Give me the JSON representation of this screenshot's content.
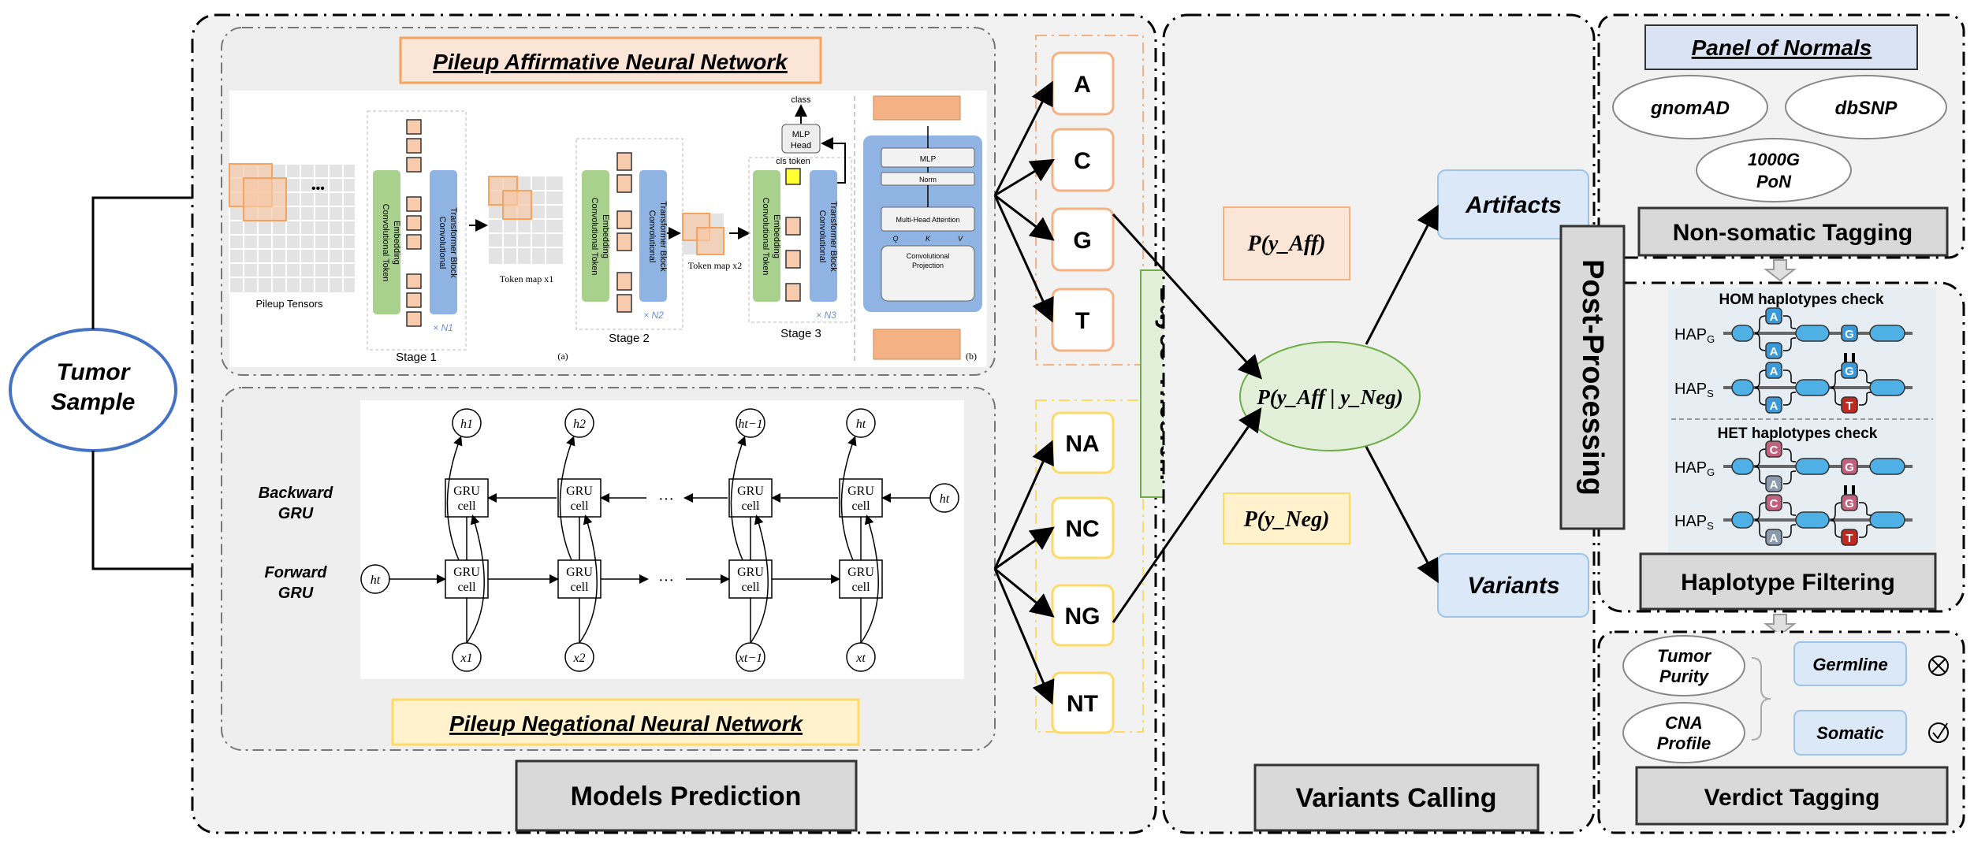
{
  "input": {
    "label_line1": "Tumor",
    "label_line2": "Sample"
  },
  "models": {
    "section_label": "Models Prediction",
    "affirmative": {
      "title": "Pileup Affirmative Neural Network",
      "pileup_tensors": "Pileup Tensors",
      "dots": "•••",
      "conv_token_embedding_l1": "Convolutional Token",
      "conv_token_embedding_l2": "Embedding",
      "conv_transformer_l1": "Convolutional",
      "conv_transformer_l2": "Transformer Block",
      "stages": [
        "Stage 1",
        "Stage 2",
        "Stage 3"
      ],
      "repeats": [
        "× N1",
        "× N2",
        "× N3"
      ],
      "token_map_1": "Token map x1",
      "token_map_2": "Token map x2",
      "cls_token": "cls token",
      "mlp_head_l1": "MLP",
      "mlp_head_l2": "Head",
      "class_label": "class",
      "panel_a": "(a)",
      "panel_b": "(b)",
      "block": {
        "mlp": "MLP",
        "norm": "Norm",
        "mha": "Multi-Head Attention",
        "q": "Q",
        "k": "K",
        "v": "V",
        "proj_l1": "Convolutional",
        "proj_l2": "Projection"
      }
    },
    "negational": {
      "title": "Pileup Negational Neural Network",
      "backward_l1": "Backward",
      "backward_l2": "GRU",
      "forward_l1": "Forward",
      "forward_l2": "GRU",
      "gru_l1": "GRU",
      "gru_l2": "cell",
      "hidden": [
        "h1",
        "h2",
        "ht−1",
        "ht"
      ],
      "inputs": [
        "x1",
        "x2",
        "xt−1",
        "xt"
      ],
      "h_init": "ht",
      "ellipsis": "···"
    },
    "aff_outputs": [
      "A",
      "C",
      "G",
      "T"
    ],
    "neg_outputs": [
      "NA",
      "NC",
      "NG",
      "NT"
    ]
  },
  "bayes": {
    "label": "Bayes' Theorem"
  },
  "calling": {
    "section_label": "Variants Calling",
    "p_aff": "P(y_Aff)",
    "p_neg": "P(y_Neg)",
    "p_joint": "P(y_Aff | y_Neg)",
    "artifacts": "Artifacts",
    "variants": "Variants"
  },
  "post": {
    "label": "Post-Processing",
    "panel_of_normals": "Panel of Normals",
    "databases": [
      "gnomAD",
      "dbSNP",
      "1000G",
      "PoN"
    ],
    "non_somatic": "Non-somatic Tagging",
    "hom_check": "HOM haplotypes check",
    "het_check": "HET haplotypes check",
    "hap_g": "HAP",
    "hap_g_sub": "G",
    "hap_s": "HAP",
    "hap_s_sub": "S",
    "haplotype_filtering": "Haplotype Filtering",
    "tumor_purity_l1": "Tumor",
    "tumor_purity_l2": "Purity",
    "cna_l1": "CNA",
    "cna_l2": "Profile",
    "germline": "Germline",
    "somatic": "Somatic",
    "verdict": "Verdict Tagging"
  },
  "colors": {
    "orange": "#f4a460",
    "orange_fill": "#fbe5d6",
    "yellow": "#ffd966",
    "yellow_fill": "#fff2cc",
    "green_fill": "#e2f0d9",
    "blue_fill": "#dae8f8",
    "gray_box": "#d9d9d9",
    "tumor_blue": "#4472c4"
  }
}
